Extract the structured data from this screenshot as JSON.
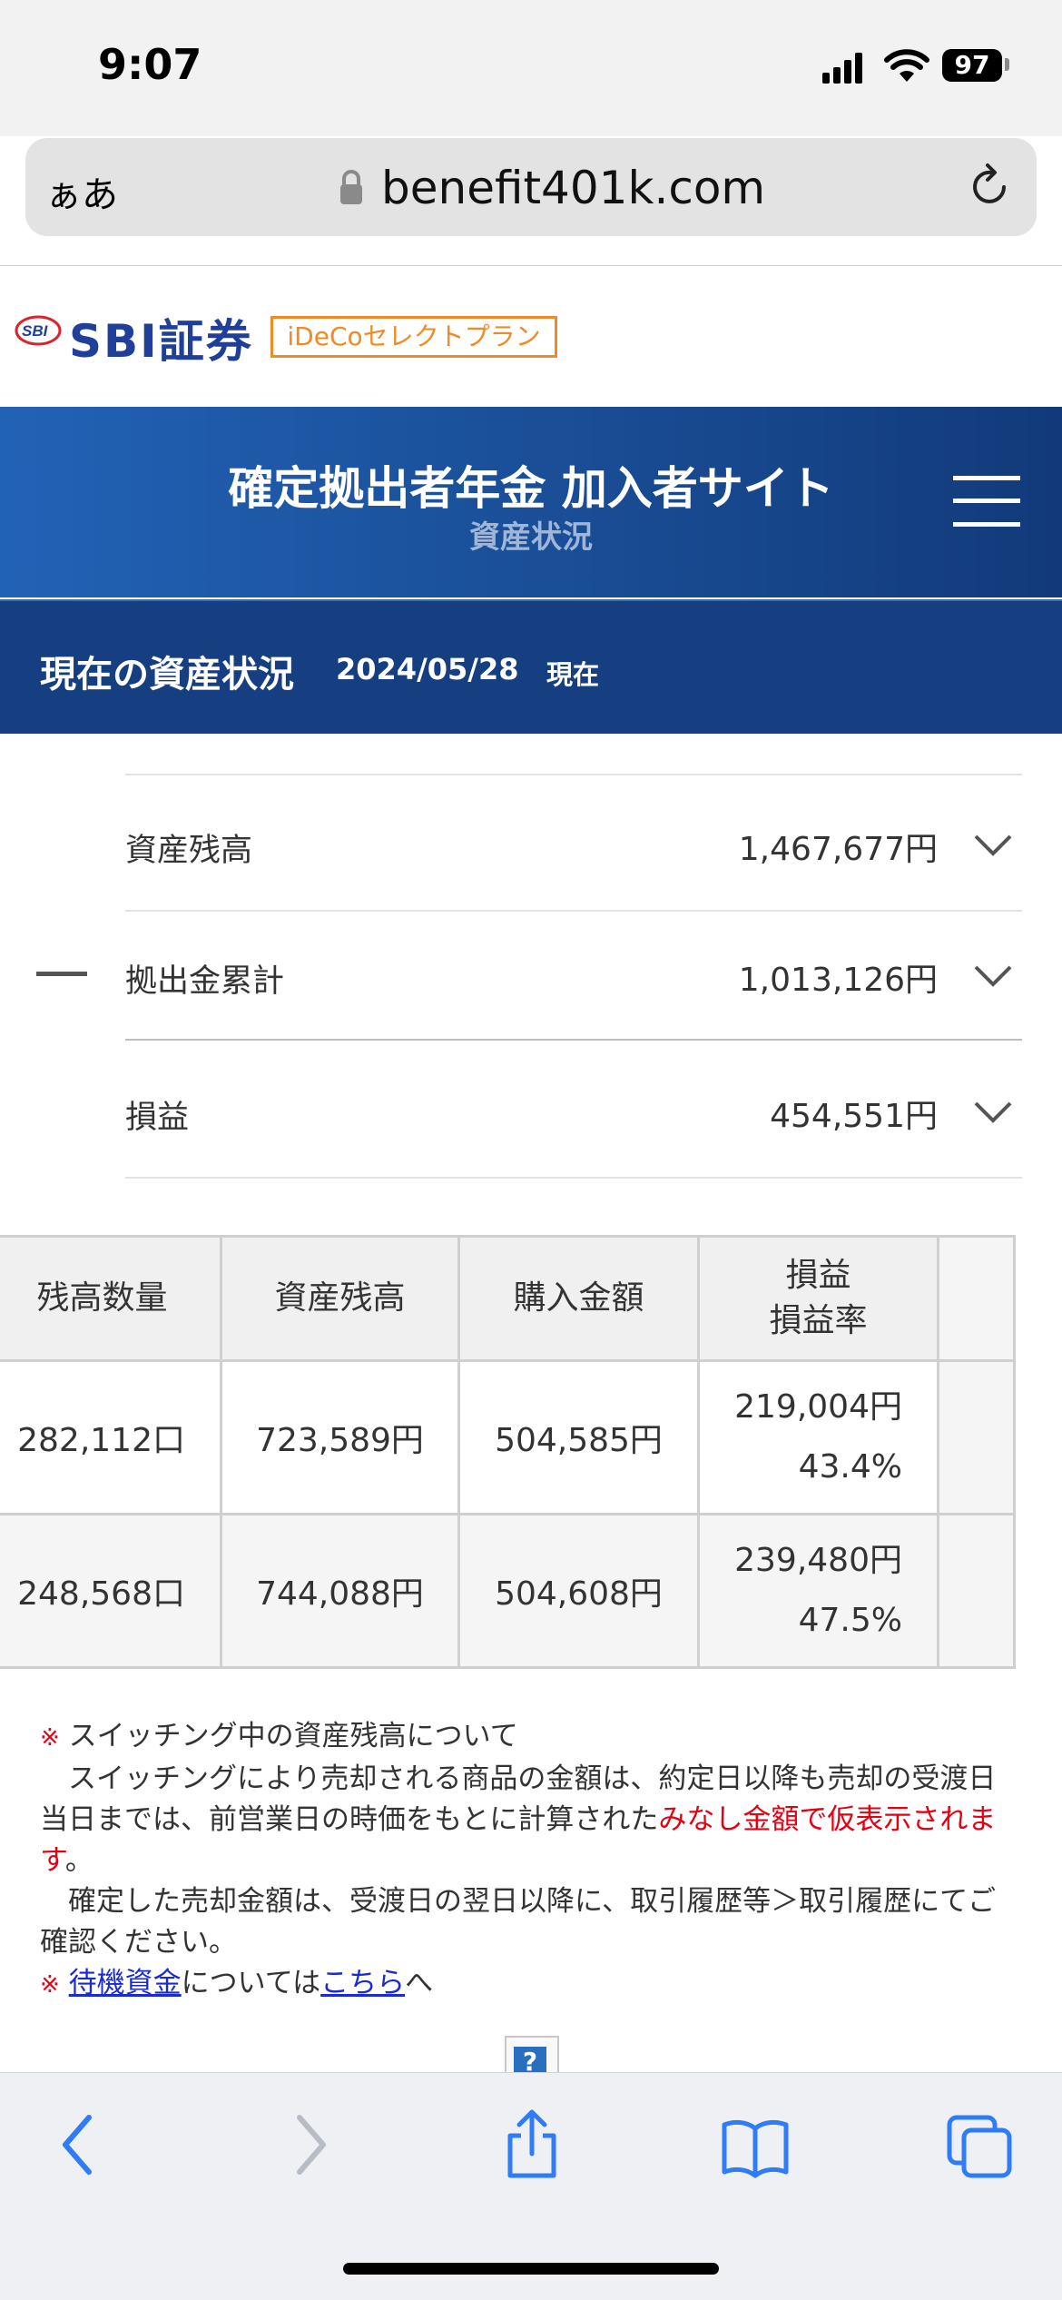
{
  "status_bar": {
    "time": "9:07",
    "battery": "97"
  },
  "browser": {
    "aa_label": "ぁあ",
    "url": "benefit401k.com"
  },
  "brand": {
    "logo_text": "SBI証券",
    "plan_badge": "iDeCoセレクトプラン"
  },
  "header": {
    "title": "確定拠出者年金 加入者サイト",
    "subtitle": "資産状況"
  },
  "section": {
    "title": "現在の資産状況",
    "date": "2024/05/28",
    "suffix": "現在"
  },
  "summary": [
    {
      "label": "資産残高",
      "value": "1,467,677円"
    },
    {
      "label": "拠出金累計",
      "value": "1,013,126円"
    },
    {
      "label": "損益",
      "value": "454,551円"
    }
  ],
  "table": {
    "headers": [
      "残高数量",
      "資産残高",
      "購入金額",
      "損益",
      "損益率"
    ],
    "rows": [
      {
        "quantity": "282,112口",
        "balance": "723,589円",
        "purchase": "504,585円",
        "pl": "219,004円",
        "pl_rate": "43.4%"
      },
      {
        "quantity": "248,568口",
        "balance": "744,088円",
        "purchase": "504,608円",
        "pl": "239,480円",
        "pl_rate": "47.5%"
      }
    ]
  },
  "notes": {
    "mark": "※",
    "note1_heading": "スイッチング中の資産残高について",
    "note1_body_a": "　スイッチングにより売却される商品の金額は、約定日以降も売却の受渡日当日までは、前営業日の時価をもとに計算された",
    "note1_body_red": "みなし金額で仮表示されます",
    "note1_body_b": "。",
    "note1_body2": "　確定した売却金額は、受渡日の翌日以降に、取引履歴等＞取引履歴にてご確認ください。",
    "note2_link1": "待機資金",
    "note2_text": "については",
    "note2_link2": "こちら",
    "note2_tail": "へ"
  },
  "help_icon": "?",
  "colors": {
    "header_blue": "#1a4f98",
    "band_blue": "#163f82",
    "badge_orange": "#f08a24",
    "note_red": "#e60012",
    "link_blue": "#1a2bd6"
  }
}
